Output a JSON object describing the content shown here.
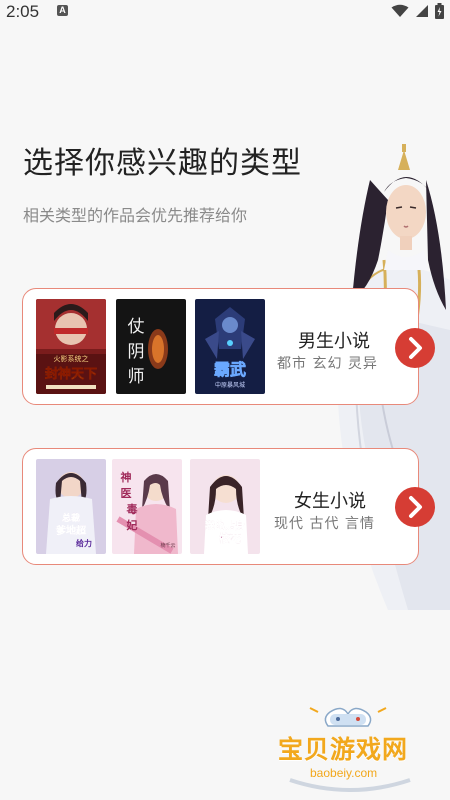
{
  "status_bar": {
    "time": "2:05",
    "notification_letter": "A",
    "icons": [
      "wifi-icon",
      "signal-icon",
      "battery-icon"
    ]
  },
  "header": {
    "title": "选择你感兴趣的类型",
    "subtitle": "相关类型的作品会优先推荐给你"
  },
  "categories": [
    {
      "label": "男生小说",
      "tags": "都市 玄幻 灵异",
      "covers": [
        {
          "text": "封神天下",
          "banner": "火影系统之",
          "bg": "#b22a2a"
        },
        {
          "text": "仗阴师",
          "bg": "#1a1a1a"
        },
        {
          "text": "霸武",
          "sub": "中原暴风城",
          "bg": "#1c2a55"
        }
      ]
    },
    {
      "label": "女生小说",
      "tags": "现代 古代 言情",
      "covers": [
        {
          "text": "总裁爹地超给力",
          "bg": "#c9c2dd"
        },
        {
          "text": "神医毒妃",
          "sub": "楠千云",
          "bg": "#f3d9e6"
        },
        {
          "text": "我的贴身校花",
          "bg": "#f1dbe6"
        }
      ]
    }
  ],
  "colors": {
    "accent": "#d63d34",
    "card_border": "#e8897a",
    "watermark": "#f2a81d"
  },
  "watermark": {
    "text": "宝贝游戏网",
    "url": "baobeiy.com"
  }
}
